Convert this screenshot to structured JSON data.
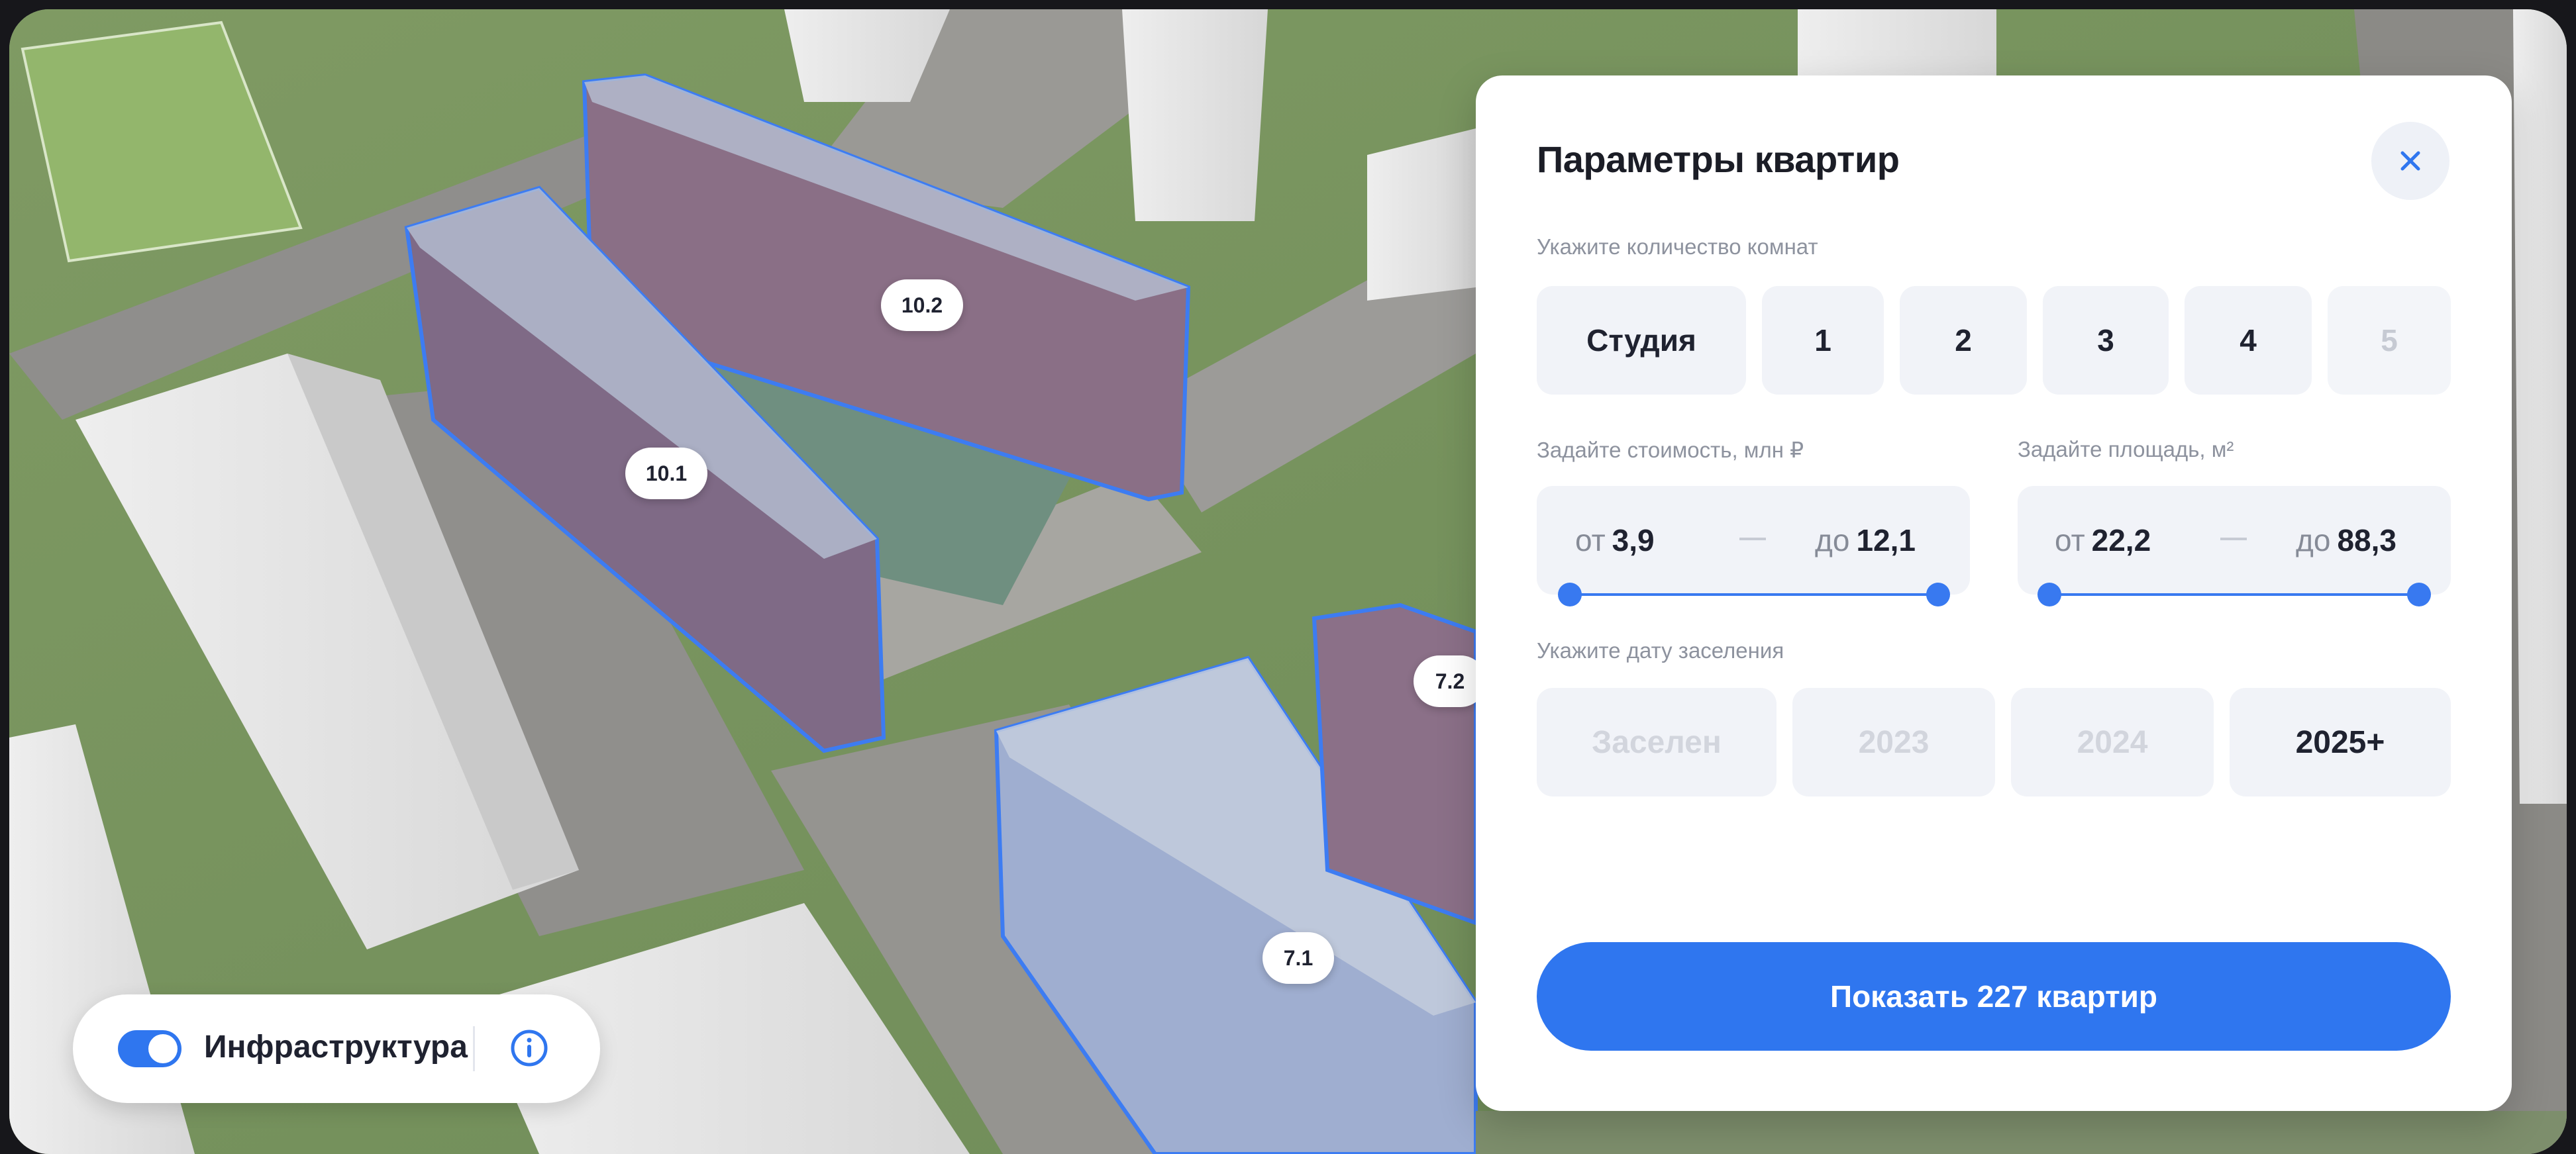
{
  "panel": {
    "title": "Параметры квартир",
    "rooms_label": "Укажите количество комнат",
    "rooms": [
      {
        "label": "Студия",
        "enabled": true
      },
      {
        "label": "1",
        "enabled": true
      },
      {
        "label": "2",
        "enabled": true
      },
      {
        "label": "3",
        "enabled": true
      },
      {
        "label": "4",
        "enabled": true
      },
      {
        "label": "5",
        "enabled": false
      }
    ],
    "price": {
      "label": "Задайте стоимость, млн ₽",
      "from_prefix": "от",
      "from_value": "3,9",
      "to_prefix": "до",
      "to_value": "12,1",
      "separator": "—"
    },
    "area": {
      "label": "Задайте площадь, м²",
      "from_prefix": "от",
      "from_value": "22,2",
      "to_prefix": "до",
      "to_value": "88,3",
      "separator": "—"
    },
    "date_label": "Укажите дату заселения",
    "dates": [
      {
        "label": "Заселен",
        "enabled": false
      },
      {
        "label": "2023",
        "enabled": false
      },
      {
        "label": "2024",
        "enabled": false
      },
      {
        "label": "2025+",
        "enabled": true
      }
    ],
    "cta": "Показать 227 квартир"
  },
  "infrastructure": {
    "label": "Инфраструктура",
    "toggle_on": true
  },
  "buildings": [
    "10.2",
    "10.1",
    "7.2",
    "7.1"
  ],
  "colors": {
    "accent": "#2f76ef",
    "highlight_outline": "#3d7cf2"
  }
}
